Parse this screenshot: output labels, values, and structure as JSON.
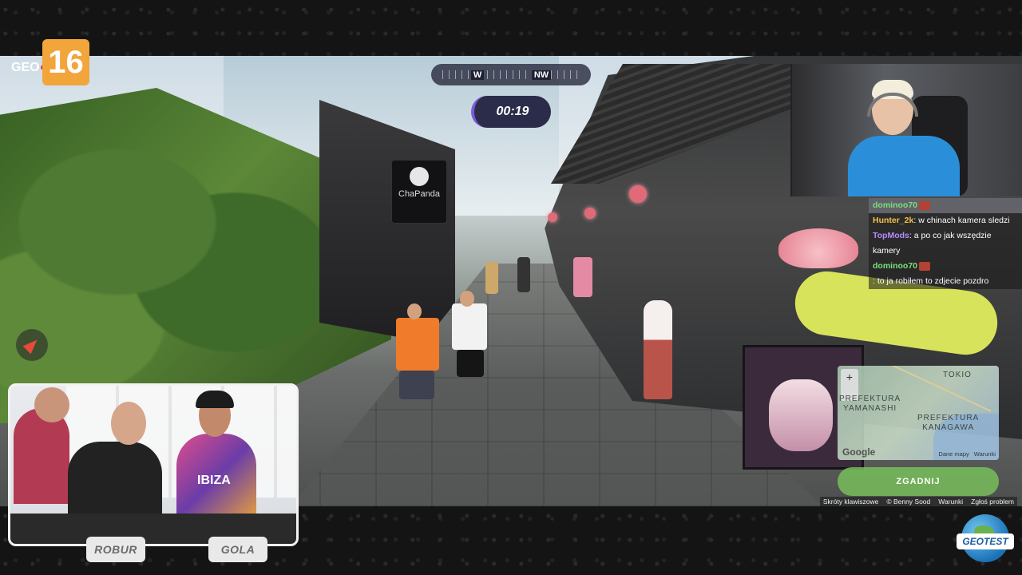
{
  "logo": {
    "prefix": "GEO",
    "number": "16"
  },
  "compass": {
    "directions": [
      "W",
      "NW"
    ]
  },
  "timer": {
    "value": "00:19"
  },
  "scene": {
    "shop_sign": "ChaPanda"
  },
  "chat": {
    "messages": [
      {
        "user": "dominoo70",
        "text": "",
        "user_color": "#7ce07c",
        "emote": true,
        "highlight": true
      },
      {
        "user": "Hunter_2k",
        "text": ": w chinach kamera sledzi",
        "user_color": "#f2c24a",
        "emote": false,
        "highlight": false
      },
      {
        "user": "TopMods",
        "text": ": a po co jak wszędzie kamery",
        "user_color": "#b78cff",
        "emote": false,
        "highlight": false
      },
      {
        "user": "dominoo70",
        "text": "",
        "user_color": "#7ce07c",
        "emote": true,
        "highlight": false
      },
      {
        "user": "",
        "text": ": to ja robiłem to zdjecie pozdro",
        "user_color": "#ff5a5a",
        "emote": false,
        "highlight": false
      }
    ]
  },
  "map": {
    "labels": {
      "tokio": "TOKIO",
      "yamanashi": "PREFEKTURA\nYAMANASHI",
      "kanagawa": "PREFEKTURA\nKANAGAWA"
    },
    "zoom_in": "+",
    "google": "Google",
    "footer": [
      "Dane mapy",
      "Warunki"
    ],
    "guess_button": "ZGADNIJ"
  },
  "attribution": [
    "Skróty klawiszowe",
    "© Benny Sood",
    "Warunki",
    "Zgłoś problem"
  ],
  "hosts": {
    "left_name": "ROBUR",
    "right_name": "GOLA",
    "shirt_text": "IBIZA"
  },
  "brand": {
    "name": "GEOTEST"
  }
}
